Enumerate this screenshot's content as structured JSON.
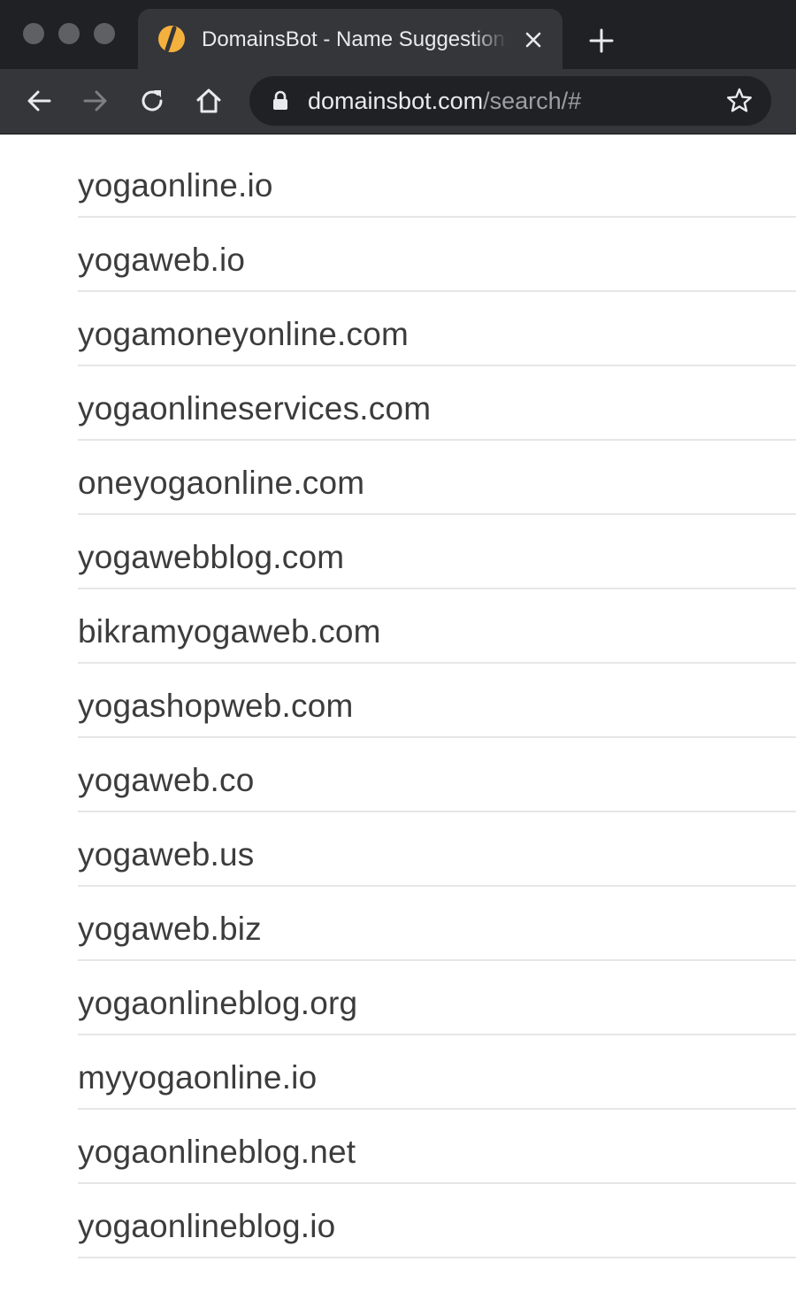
{
  "browser": {
    "tab": {
      "title": "DomainsBot - Name Suggestions",
      "favicon": "domainsbot-logo-icon"
    },
    "address_bar": {
      "host": "domainsbot.com",
      "path": "/search/#"
    },
    "icons": {
      "back": "back-arrow-icon",
      "forward": "forward-arrow-icon",
      "reload": "reload-icon",
      "home": "home-icon",
      "lock": "lock-icon",
      "bookmark": "star-icon",
      "close_tab": "close-icon",
      "new_tab": "plus-icon"
    },
    "colors": {
      "chrome_dark": "#202124",
      "chrome_tab": "#35363a",
      "favicon_accent": "#f4b13d"
    }
  },
  "results": [
    {
      "name": "yogaonline.io"
    },
    {
      "name": "yogaweb.io"
    },
    {
      "name": "yogamoneyonline.com"
    },
    {
      "name": "yogaonlineservices.com"
    },
    {
      "name": "oneyogaonline.com"
    },
    {
      "name": "yogawebblog.com"
    },
    {
      "name": "bikramyogaweb.com"
    },
    {
      "name": "yogashopweb.com"
    },
    {
      "name": "yogaweb.co"
    },
    {
      "name": "yogaweb.us"
    },
    {
      "name": "yogaweb.biz"
    },
    {
      "name": "yogaonlineblog.org"
    },
    {
      "name": "myyogaonline.io"
    },
    {
      "name": "yogaonlineblog.net"
    },
    {
      "name": "yogaonlineblog.io"
    }
  ]
}
